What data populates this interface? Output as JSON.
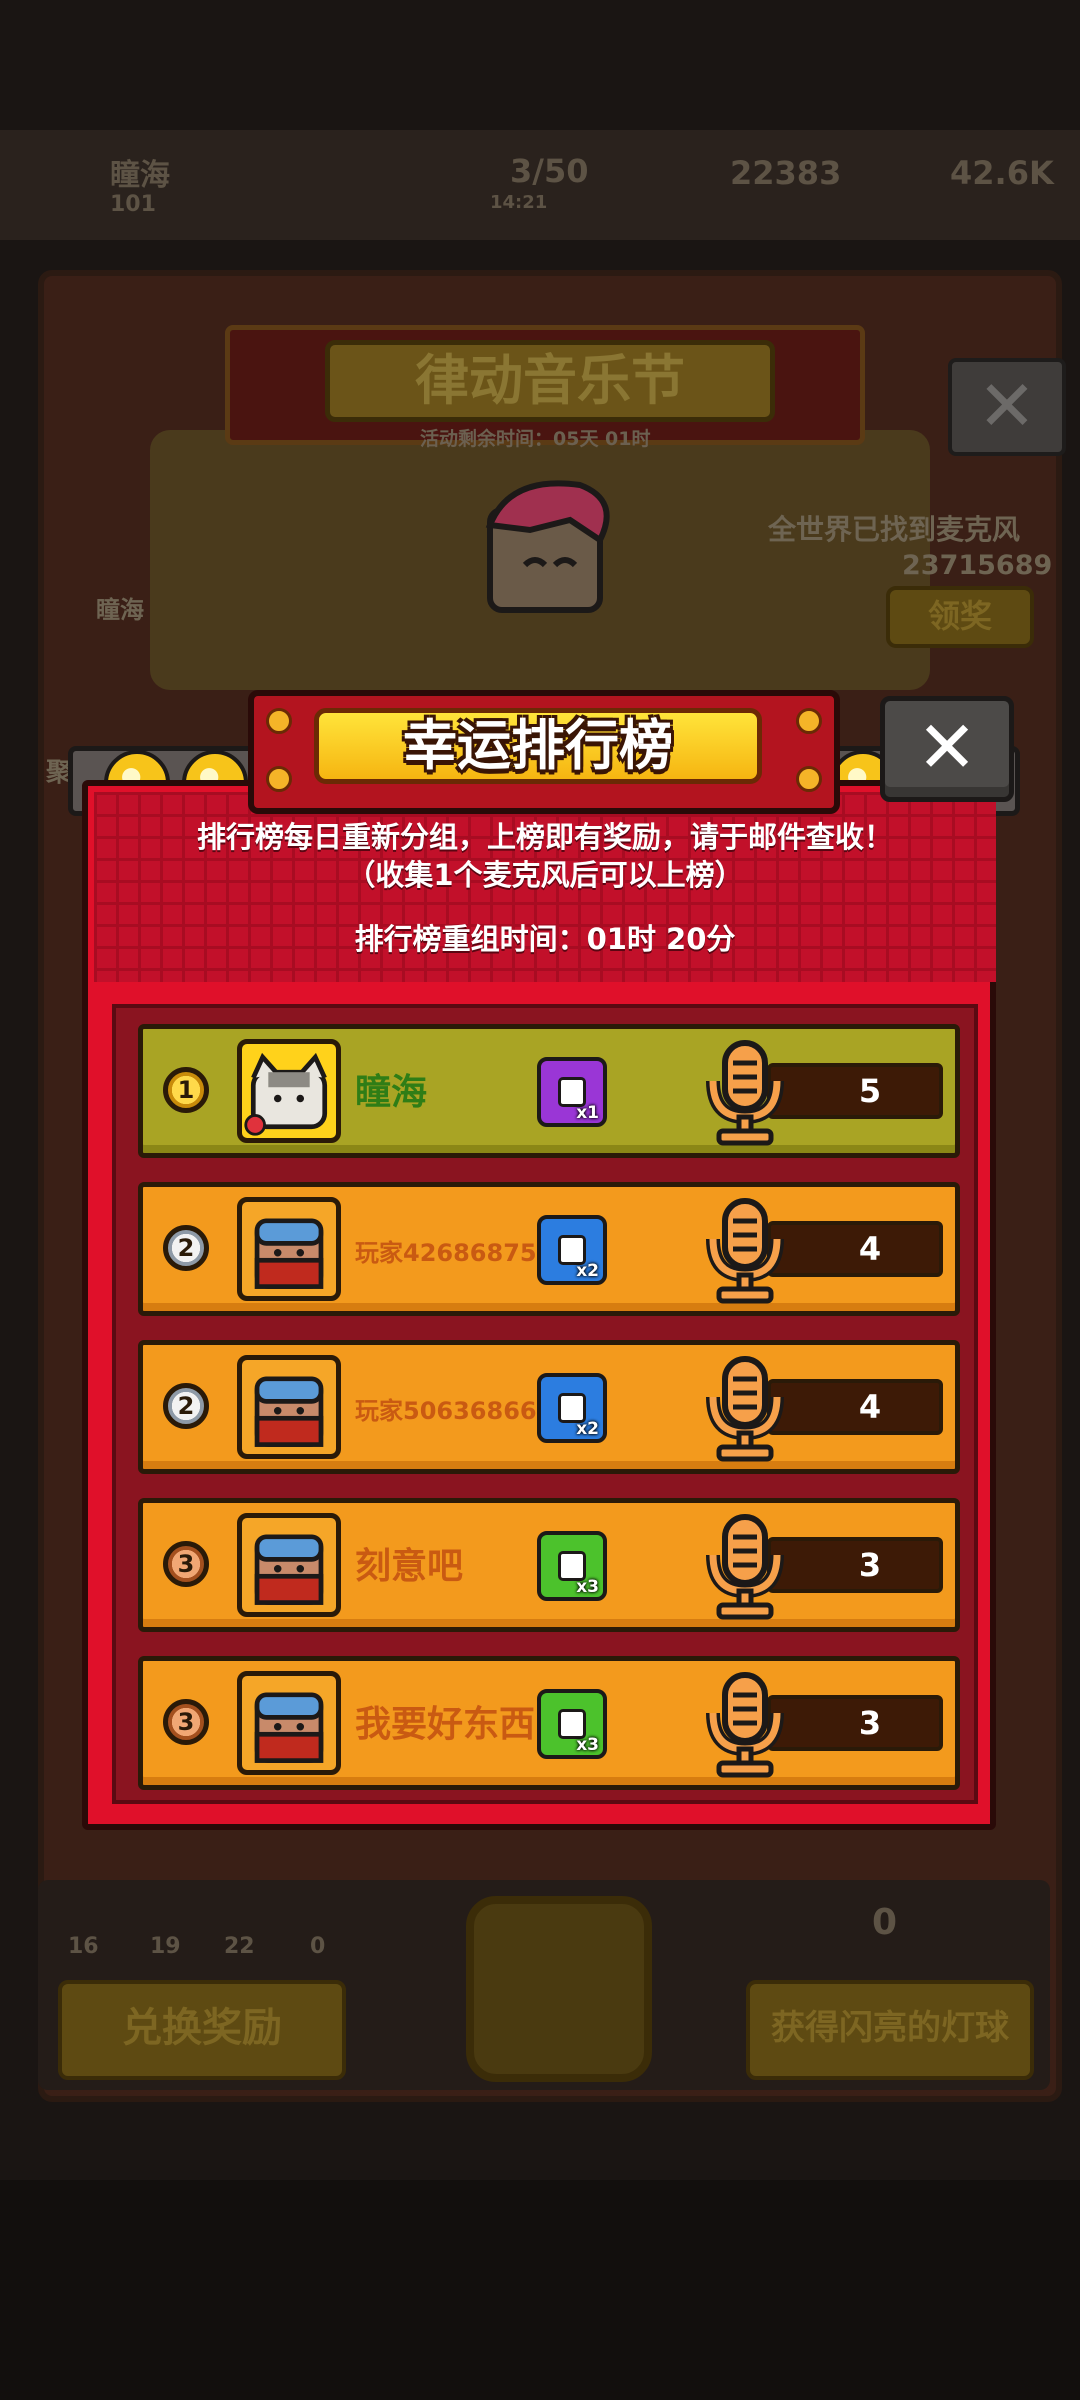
{
  "background": {
    "player_name": "瞳海",
    "level": "101",
    "energy": "3/50",
    "energy_timer": "14:21",
    "gems": "22383",
    "coins": "42.6K",
    "event_title": "律动音乐节",
    "event_time_left": "活动剩余时间：05天 01时",
    "world_found_label": "全世界已找到麦克风",
    "world_found_count": "23715689",
    "claim_button": "领奖",
    "avatar_name": "瞳海",
    "side_label": "聚",
    "note_counts": [
      "16",
      "19",
      "22",
      "0"
    ],
    "exchange_button": "兑换奖励",
    "get_light_button": "获得闪亮的灯球",
    "lightball_count": "0",
    "unlock_multiplier": "x2"
  },
  "modal": {
    "title": "幸运排行榜",
    "close_label": "✕",
    "info_line1": "排行榜每日重新分组，上榜即有奖励，请于邮件查收！",
    "info_line2": "（收集1个麦克风后可以上榜）",
    "reset_label": "排行榜重组时间：01时 20分"
  },
  "leaderboard": [
    {
      "rank": "1",
      "name": "瞳海",
      "reward_qty": "x1",
      "reward_color": "#9a36d6",
      "score": "5",
      "name_color": "#2f7d16",
      "is_me": true
    },
    {
      "rank": "2",
      "name": "玩家42686875",
      "reward_qty": "x2",
      "reward_color": "#2c7de0",
      "score": "4",
      "name_color": "#c95a12",
      "is_me": false
    },
    {
      "rank": "2",
      "name": "玩家50636866",
      "reward_qty": "x2",
      "reward_color": "#2c7de0",
      "score": "4",
      "name_color": "#c95a12",
      "is_me": false
    },
    {
      "rank": "3",
      "name": "刻意吧",
      "reward_qty": "x3",
      "reward_color": "#4cc22c",
      "score": "3",
      "name_color": "#c95a12",
      "is_me": false
    },
    {
      "rank": "3",
      "name": "我要好东西",
      "reward_qty": "x3",
      "reward_color": "#4cc22c",
      "score": "3",
      "name_color": "#c95a12",
      "is_me": false
    }
  ],
  "colors": {
    "frame_red": "#e0102a",
    "row_orange": "#f39a1d",
    "row_highlight": "#a9a424",
    "title_gold": "#f6b511"
  }
}
